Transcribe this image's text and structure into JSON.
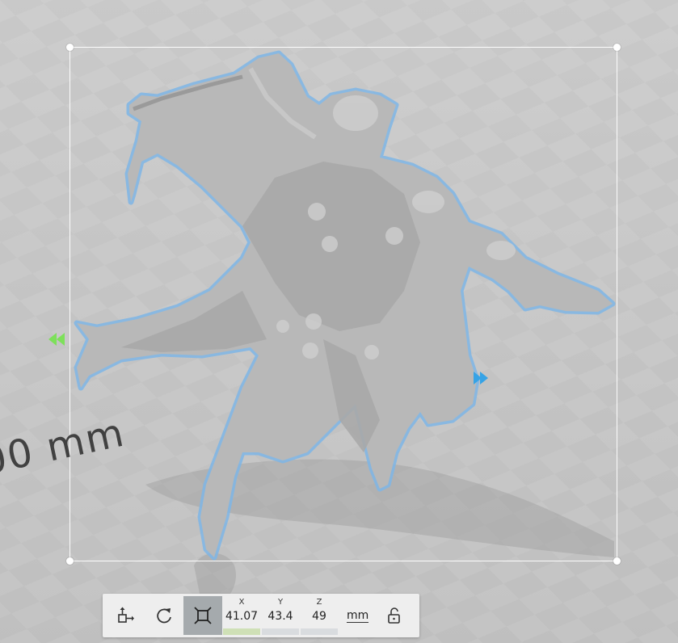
{
  "viewport": {
    "ruler_label": "00 mm",
    "background_color": "#c8c8c8",
    "selection_color": "#7fb6e6",
    "model_color": "#b9b9b9"
  },
  "toolbar": {
    "tools": [
      {
        "name": "move",
        "icon": "move-icon",
        "active": false
      },
      {
        "name": "rotate",
        "icon": "rotate-icon",
        "active": false
      },
      {
        "name": "scale",
        "icon": "scale-icon",
        "active": true
      }
    ],
    "dimensions": [
      {
        "axis": "X",
        "value": "41.07",
        "color": "#cfe0b6"
      },
      {
        "axis": "Y",
        "value": "43.4",
        "color": "#d9dcdf"
      },
      {
        "axis": "Z",
        "value": "49",
        "color": "#d9dcdf"
      }
    ],
    "unit": "mm",
    "lock_icon": "unlock-icon"
  }
}
